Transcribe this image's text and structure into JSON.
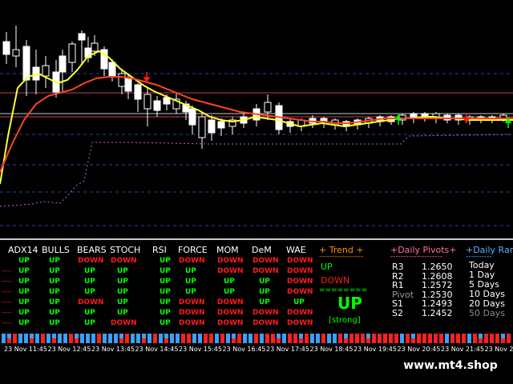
{
  "colors": {
    "up": "#00ff00",
    "down": "#ff1a1a",
    "orange": "#ff8c00",
    "pink": "#ff6fa8",
    "blue": "#5ab4ff",
    "sma_fast": "#ffff33",
    "sma_slow": "#ff4422",
    "bull_bar": "#3aa0ff",
    "bear_bar": "#ff2020"
  },
  "indicator_headers": [
    "ADX14",
    "BULLS",
    "BEARS",
    "STOCH",
    "RSI",
    "FORCE",
    "MOM",
    "DeM",
    "WAE"
  ],
  "indicator_rows": [
    [
      "UP",
      "UP",
      "DOWN",
      "DOWN",
      "UP",
      "DOWN",
      "DOWN",
      "DOWN",
      "DOWN"
    ],
    [
      "UP",
      "UP",
      "UP",
      "UP",
      "UP",
      "UP",
      "DOWN",
      "DOWN",
      "DOWN"
    ],
    [
      "UP",
      "UP",
      "UP",
      "UP",
      "UP",
      "UP",
      "UP",
      "UP",
      "DOWN"
    ],
    [
      "UP",
      "UP",
      "UP",
      "UP",
      "UP",
      "UP",
      "UP",
      "UP",
      "DOWN"
    ],
    [
      "UP",
      "UP",
      "DOWN",
      "UP",
      "UP",
      "DOWN",
      "DOWN",
      "UP",
      "UP"
    ],
    [
      "UP",
      "UP",
      "UP",
      "UP",
      "UP",
      "DOWN",
      "DOWN",
      "DOWN",
      "DOWN"
    ],
    [
      "UP",
      "UP",
      "UP",
      "DOWN",
      "UP",
      "DOWN",
      "DOWN",
      "DOWN",
      "DOWN"
    ]
  ],
  "trend": {
    "title": "+ Trend +",
    "up_label": "UP",
    "down_label": "DOWN",
    "big_label": "UP",
    "strength": "[strong]"
  },
  "pivots": {
    "title": "+Daily Pivots+",
    "rows": [
      {
        "label": "R3",
        "value": "1.2650"
      },
      {
        "label": "R2",
        "value": "1.2608"
      },
      {
        "label": "R1",
        "value": "1.2572"
      },
      {
        "label": "Pivot",
        "value": "1.2530"
      },
      {
        "label": "S1",
        "value": "1.2493"
      },
      {
        "label": "S2",
        "value": "1.2452"
      }
    ]
  },
  "ranges": {
    "title": "+Daily Rang",
    "items": [
      "Today",
      "1 Day",
      "5 Days",
      "10 Days",
      "20 Days",
      "50 Days"
    ]
  },
  "time_labels": [
    "23 Nov 11:45",
    "23 Nov 12:45",
    "23 Nov 13:45",
    "23 Nov 14:45",
    "23 Nov 15:45",
    "23 Nov 16:45",
    "23 Nov 17:45",
    "23 Nov 18:45",
    "23 Nov 19:45",
    "23 Nov 20:45",
    "23 Nov 21:45",
    "23 Nov 2"
  ],
  "watermark": "www.mt4.shop"
}
